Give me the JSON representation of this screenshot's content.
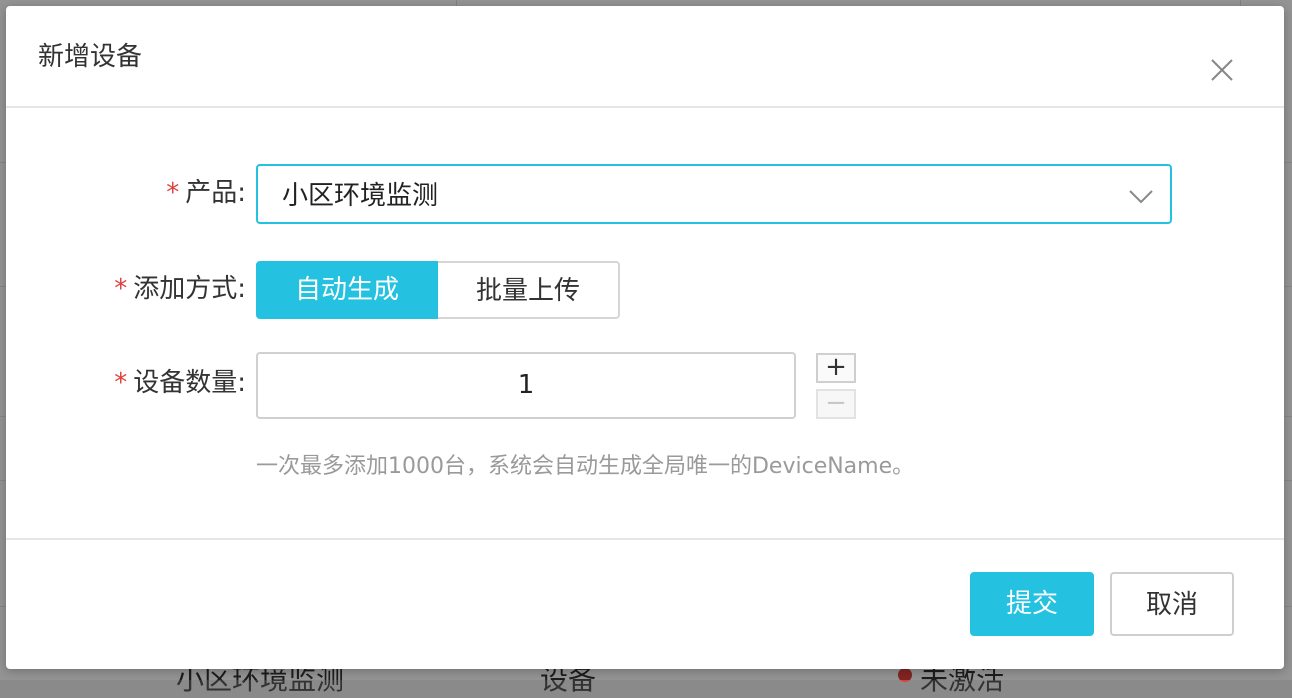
{
  "background": {
    "row_product": "小区环境监测",
    "row_node_type": "设备",
    "row_status": "未激活",
    "status_color": "#e0413c"
  },
  "dialog": {
    "title": "新增设备",
    "close_icon": "close-icon",
    "fields": {
      "product": {
        "required_mark": "*",
        "label": "产品:",
        "value": "小区环境监测",
        "icon": "chevron-down-icon"
      },
      "add_method": {
        "required_mark": "*",
        "label": "添加方式:",
        "options": [
          "自动生成",
          "批量上传"
        ],
        "selected": "自动生成"
      },
      "device_count": {
        "required_mark": "*",
        "label": "设备数量:",
        "value": "1",
        "increment": "+",
        "decrement": "−"
      }
    },
    "hint": "一次最多添加1000台，系统会自动生成全局唯一的DeviceName。",
    "buttons": {
      "submit": "提交",
      "cancel": "取消"
    }
  },
  "colors": {
    "accent": "#25c1e0",
    "required": "#e0413c",
    "hint": "#9a9a9a"
  }
}
